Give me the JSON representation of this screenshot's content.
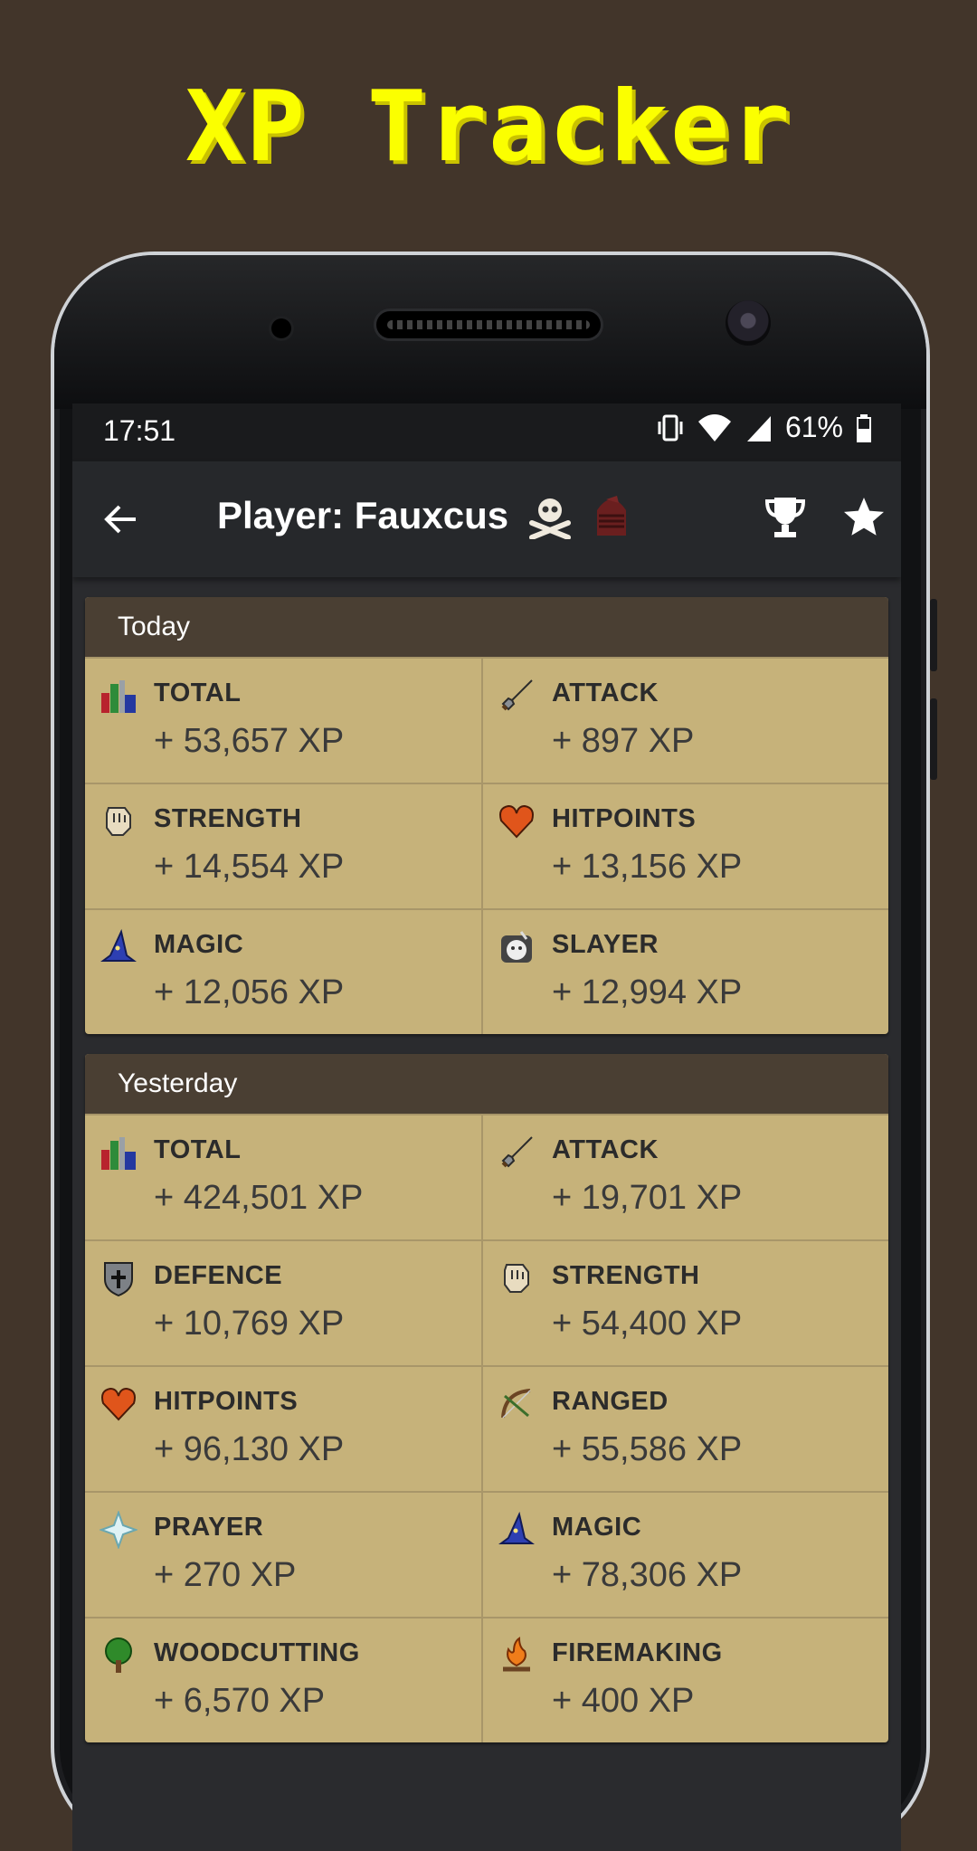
{
  "promo_title": "XP Tracker",
  "status_bar": {
    "time": "17:51",
    "battery": "61%"
  },
  "app_bar": {
    "title": "Player: Fauxcus"
  },
  "cards": [
    {
      "header": "Today",
      "skills": [
        {
          "name": "TOTAL",
          "xp": "+ 53,657 XP",
          "icon": "total-icon"
        },
        {
          "name": "ATTACK",
          "xp": "+ 897 XP",
          "icon": "attack-icon"
        },
        {
          "name": "STRENGTH",
          "xp": "+ 14,554 XP",
          "icon": "strength-icon"
        },
        {
          "name": "HITPOINTS",
          "xp": "+ 13,156 XP",
          "icon": "hitpoints-icon"
        },
        {
          "name": "MAGIC",
          "xp": "+ 12,056 XP",
          "icon": "magic-icon"
        },
        {
          "name": "SLAYER",
          "xp": "+ 12,994 XP",
          "icon": "slayer-icon"
        }
      ]
    },
    {
      "header": "Yesterday",
      "skills": [
        {
          "name": "TOTAL",
          "xp": "+ 424,501 XP",
          "icon": "total-icon"
        },
        {
          "name": "ATTACK",
          "xp": "+ 19,701 XP",
          "icon": "attack-icon"
        },
        {
          "name": "DEFENCE",
          "xp": "+ 10,769 XP",
          "icon": "defence-icon"
        },
        {
          "name": "STRENGTH",
          "xp": "+ 54,400 XP",
          "icon": "strength-icon"
        },
        {
          "name": "HITPOINTS",
          "xp": "+ 96,130 XP",
          "icon": "hitpoints-icon"
        },
        {
          "name": "RANGED",
          "xp": "+ 55,586 XP",
          "icon": "ranged-icon"
        },
        {
          "name": "PRAYER",
          "xp": "+ 270 XP",
          "icon": "prayer-icon"
        },
        {
          "name": "MAGIC",
          "xp": "+ 78,306 XP",
          "icon": "magic-icon"
        },
        {
          "name": "WOODCUTTING",
          "xp": "+ 6,570 XP",
          "icon": "woodcutting-icon"
        },
        {
          "name": "FIREMAKING",
          "xp": "+ 400 XP",
          "icon": "firemaking-icon"
        }
      ]
    }
  ]
}
